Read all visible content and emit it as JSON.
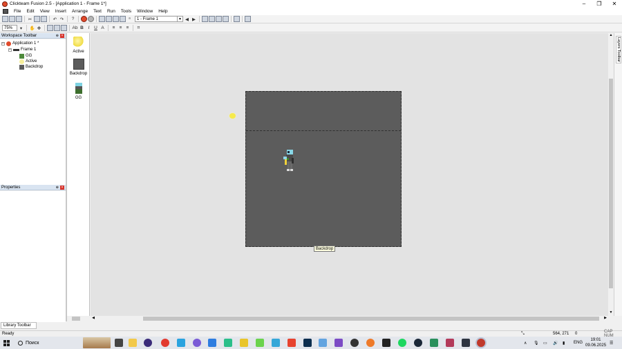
{
  "window": {
    "title": "Clickteam Fusion 2.5 - [Application 1 - Frame 1*]",
    "controls": [
      "–",
      "❐",
      "✕"
    ]
  },
  "menu": [
    "File",
    "Edit",
    "View",
    "Insert",
    "Arrange",
    "Text",
    "Run",
    "Tools",
    "Window",
    "Help"
  ],
  "toolbar": {
    "frame_select": "1 - Frame 1",
    "zoom": "75%"
  },
  "workspace": {
    "title": "Workspace Toolbar",
    "tree": {
      "application": "Application 1 *",
      "frame": "Frame 1",
      "objects": [
        "GG",
        "Active",
        "Backdrop"
      ]
    }
  },
  "properties": {
    "title": "Properties"
  },
  "object_bar": [
    {
      "label": "Active",
      "icon": "active-sprite-icon"
    },
    {
      "label": "Backdrop",
      "icon": "backdrop-icon"
    },
    {
      "label": "GG",
      "icon": "gg-character-icon"
    }
  ],
  "editor": {
    "tooltip": "Backdrop"
  },
  "layers_tab": "Layers Toolbar",
  "library_tab": "Library Toolbar",
  "status": {
    "ready": "Ready",
    "coords": "564, 271",
    "objects": "0",
    "caps": "CAP NUM"
  },
  "taskbar": {
    "search": "Поиск",
    "language": "ENG",
    "time": "19:01",
    "date": "09.06.2025"
  },
  "colors": {
    "frame_background": "#5c5c5c",
    "editor_background": "#e3e3e3",
    "accent_red": "#e04a2b"
  }
}
